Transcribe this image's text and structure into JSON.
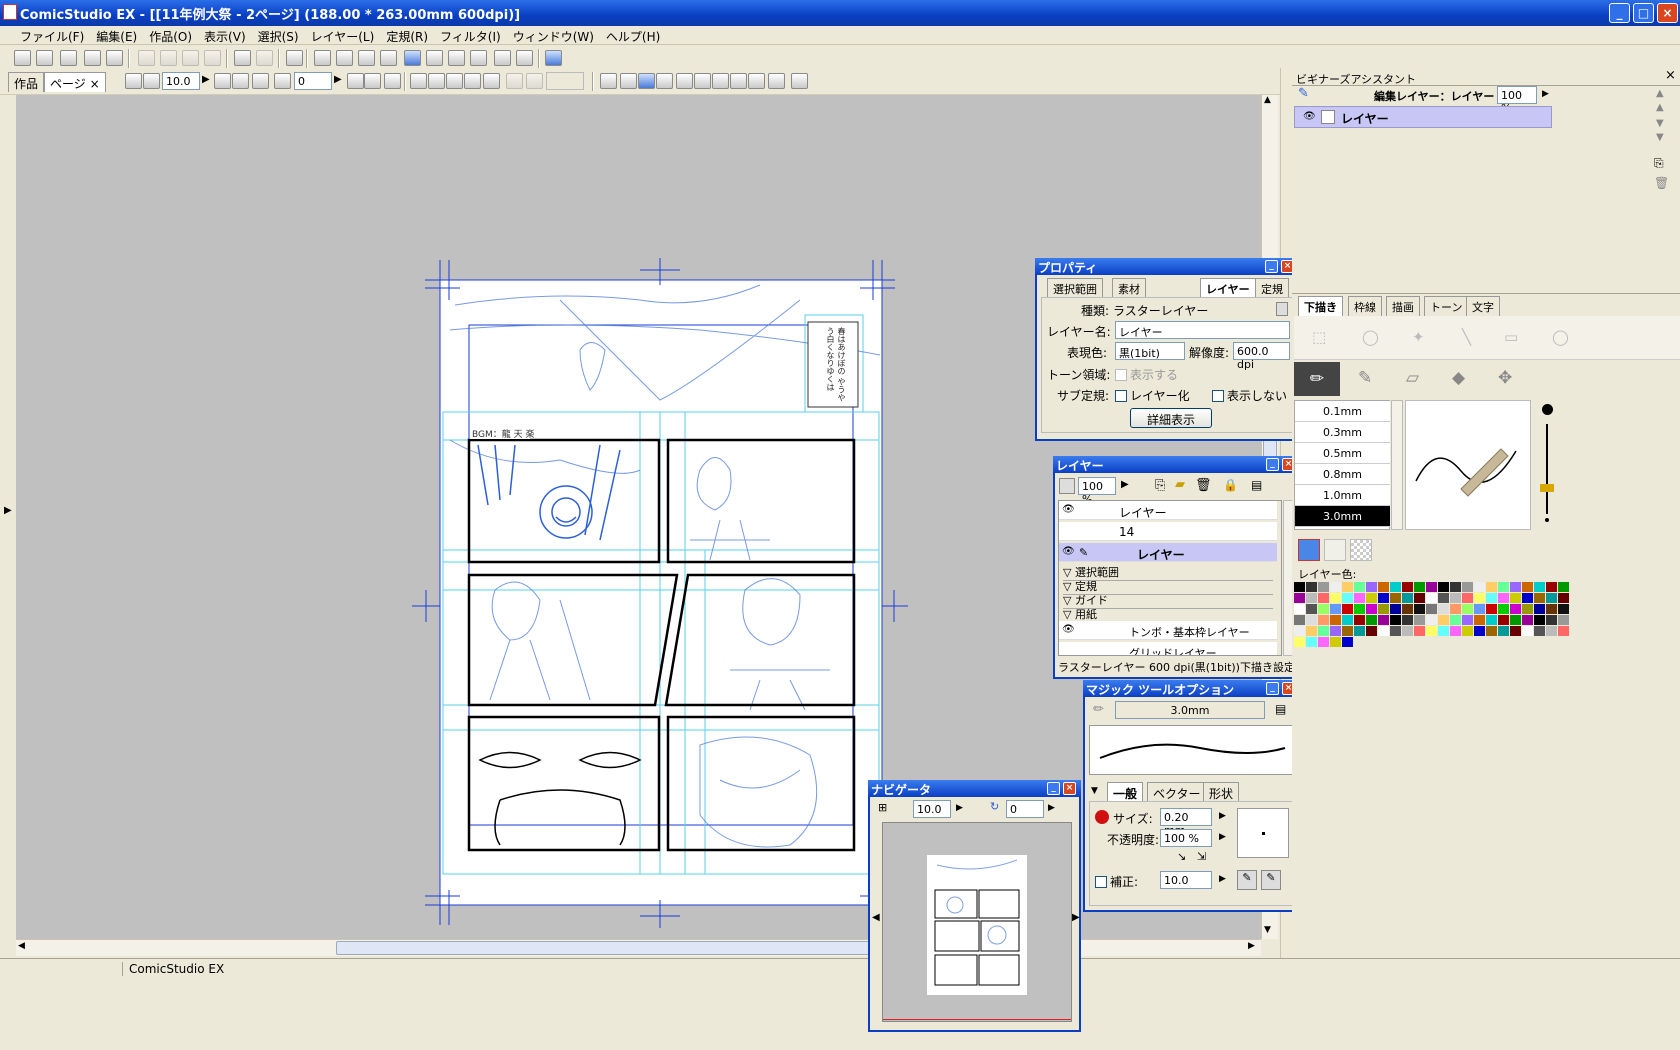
{
  "window": {
    "title": "ComicStudio EX - [[11年例大祭 - 2ページ] (188.00 * 263.00mm 600dpi)]",
    "min": "_",
    "max": "□",
    "close": "×"
  },
  "menu": [
    "ファイル(F)",
    "編集(E)",
    "作品(O)",
    "表示(V)",
    "選択(S)",
    "レイヤー(L)",
    "定規(R)",
    "フィルタ(I)",
    "ウィンドウ(W)",
    "ヘルプ(H)"
  ],
  "mdi": {
    "min": "–",
    "restore": "❐",
    "close": "×"
  },
  "pagebar": {
    "tab_work": "作品",
    "tab_page": "ページ",
    "tab_close": "×",
    "zoom": "10.0",
    "rotate": "0"
  },
  "canvas": {
    "bgm_label": "BGM：龍 天 楽",
    "vertical_text": "春はあけぼの やうやう白くなりゆくは"
  },
  "statusbar": {
    "text": "ComicStudio EX"
  },
  "properties": {
    "title": "プロパティ",
    "tabs": [
      "選択範囲",
      "素材",
      "レイヤー",
      "定規"
    ],
    "kind_label": "種類:",
    "kind_value": "ラスターレイヤー",
    "name_label": "レイヤー名:",
    "name_value": "レイヤー",
    "color_label": "表現色:",
    "color_value": "黒(1bit)",
    "res_label": "解像度:",
    "res_value": "600.0 dpi",
    "tone_label": "トーン領域:",
    "tone_check": "表示する",
    "sub_label": "サブ定規:",
    "sub_check1": "レイヤー化",
    "sub_check2": "表示しない",
    "detail_button": "詳細表示"
  },
  "layers": {
    "title": "レイヤー",
    "opacity": "100 %",
    "rows": [
      "レイヤー",
      "14",
      "レイヤー"
    ],
    "folders": [
      "選択範囲",
      "定規",
      "ガイド",
      "用紙"
    ],
    "sub_row": "トンボ・基本枠レイヤー",
    "sub_row2": "グリッドレイヤー",
    "status": "ラスターレイヤー 600 dpi(黒(1bit))下描き設定"
  },
  "magic": {
    "title": "マジック ツールオプション",
    "size_value": "3.0mm",
    "tabs": [
      "一般",
      "ベクター",
      "形状"
    ],
    "size_label": "サイズ:",
    "size_field": "0.20 mm",
    "opacity_label": "不透明度:",
    "opacity_field": "100 %",
    "correction_label": "補正:",
    "correction_field": "10.0"
  },
  "navigator": {
    "title": "ナビゲータ",
    "zoom": "10.0",
    "rotate": "0"
  },
  "assistant": {
    "title": "ビギナーズアシスタント",
    "edit_layer_label": "編集レイヤー：レイヤー",
    "opacity": "100 %",
    "layer_row": "レイヤー",
    "tabs": [
      "下描き",
      "枠線",
      "描画",
      "トーン",
      "文字"
    ],
    "sizes": [
      "0.1mm",
      "0.3mm",
      "0.5mm",
      "0.8mm",
      "1.0mm",
      "3.0mm"
    ],
    "layer_color_label": "レイヤー色:"
  },
  "colors": {
    "accent": "#0a3fc4",
    "selection": "#c7c6f5",
    "sketch": "#4a7ad8",
    "guide": "#5ad0e8"
  }
}
